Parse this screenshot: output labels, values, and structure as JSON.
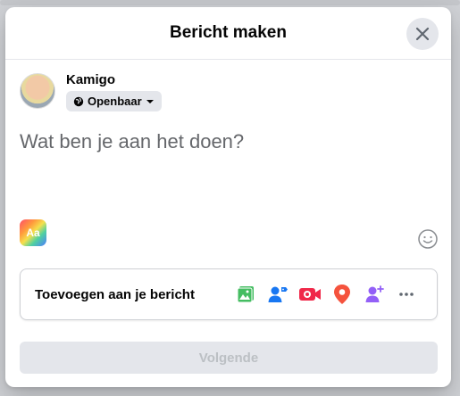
{
  "modal": {
    "title": "Bericht maken",
    "close_icon": "close-icon"
  },
  "user": {
    "name": "Kamigo",
    "privacy_label": "Openbaar",
    "privacy_icon": "globe-icon"
  },
  "composer": {
    "placeholder": "Wat ben je aan het doen?",
    "style_button_label": "Aa",
    "emoji_icon": "smiley-icon"
  },
  "add_to_post": {
    "label": "Toevoegen aan je bericht",
    "icons": [
      {
        "name": "photo-video-icon",
        "color": "#45bd62"
      },
      {
        "name": "tag-people-icon",
        "color": "#1877f2"
      },
      {
        "name": "live-video-icon",
        "color": "#f02849"
      },
      {
        "name": "check-in-icon",
        "color": "#f5533d"
      },
      {
        "name": "invite-people-icon",
        "color": "#9360f7"
      },
      {
        "name": "more-icon",
        "color": "#606770"
      }
    ]
  },
  "footer": {
    "next_label": "Volgende"
  },
  "colors": {
    "modal_bg": "#ffffff",
    "button_disabled_bg": "#e4e6eb",
    "button_disabled_text": "#bcc0c4",
    "placeholder_text": "#65676b"
  }
}
